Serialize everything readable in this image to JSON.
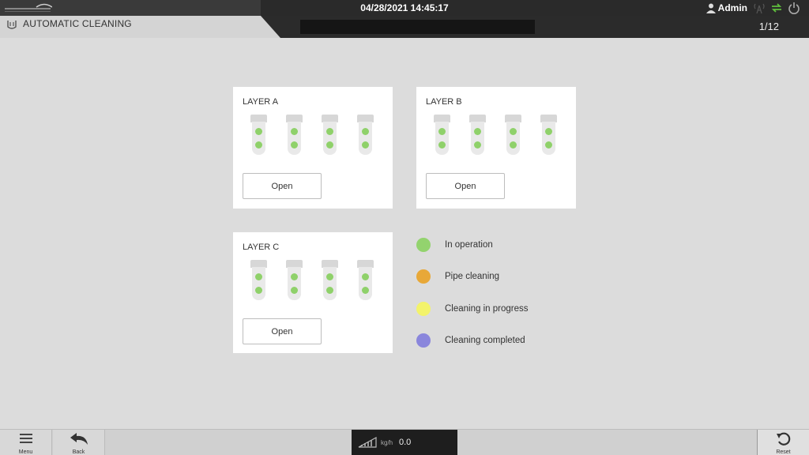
{
  "header": {
    "datetime": "04/28/2021 14:45:17",
    "user": "Admin",
    "title": "AUTOMATIC CLEANING",
    "page_indicator": "1/12",
    "icons": [
      "logo-icon",
      "user-icon",
      "antenna-icon",
      "sync-icon",
      "power-icon",
      "cleaning-icon"
    ]
  },
  "layers": [
    {
      "title": "LAYER A",
      "button": "Open",
      "tubes": 4,
      "status_color": "#8fd16a"
    },
    {
      "title": "LAYER B",
      "button": "Open",
      "tubes": 4,
      "status_color": "#8fd16a"
    },
    {
      "title": "LAYER C",
      "button": "Open",
      "tubes": 4,
      "status_color": "#8fd16a"
    }
  ],
  "legend": [
    {
      "label": "In operation",
      "color": "#93d36e"
    },
    {
      "label": "Pipe cleaning",
      "color": "#e8a838"
    },
    {
      "label": "Cleaning in progress",
      "color": "#f3f36a"
    },
    {
      "label": "Cleaning completed",
      "color": "#8a86dc"
    }
  ],
  "footer": {
    "menu_label": "Menu",
    "back_label": "Back",
    "flow_unit": "kg/h",
    "flow_value": "0.0",
    "reset_label": "Reset"
  }
}
